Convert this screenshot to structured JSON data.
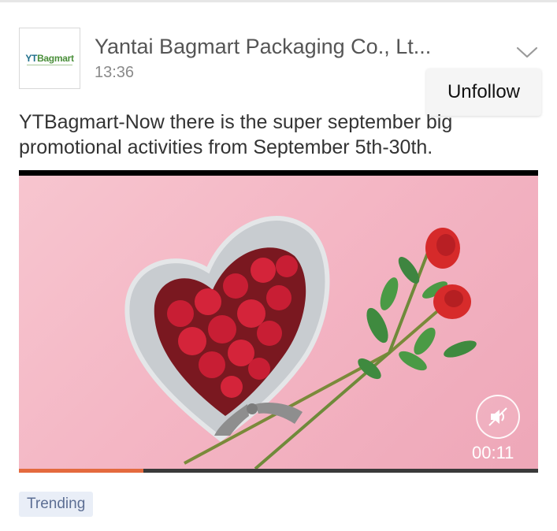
{
  "post": {
    "account_logo": {
      "part1": "YT",
      "part2": "Bagmart"
    },
    "account_name": "Yantai Bagmart Packaging Co., Lt...",
    "time": "13:36",
    "text": "YTBagmart-Now there is the super september big promotional activities from September 5th-30th."
  },
  "menu": {
    "chevron_icon": "chevron-down-icon",
    "unfollow_label": "Unfollow"
  },
  "video": {
    "duration": "00:11",
    "progress": 0.24,
    "mute_icon": "speaker-muted-icon"
  },
  "tag": {
    "label": "Trending"
  },
  "colors": {
    "progress": "#e46a3e",
    "tag_bg": "#e9eef7",
    "tag_text": "#5d6f94"
  }
}
